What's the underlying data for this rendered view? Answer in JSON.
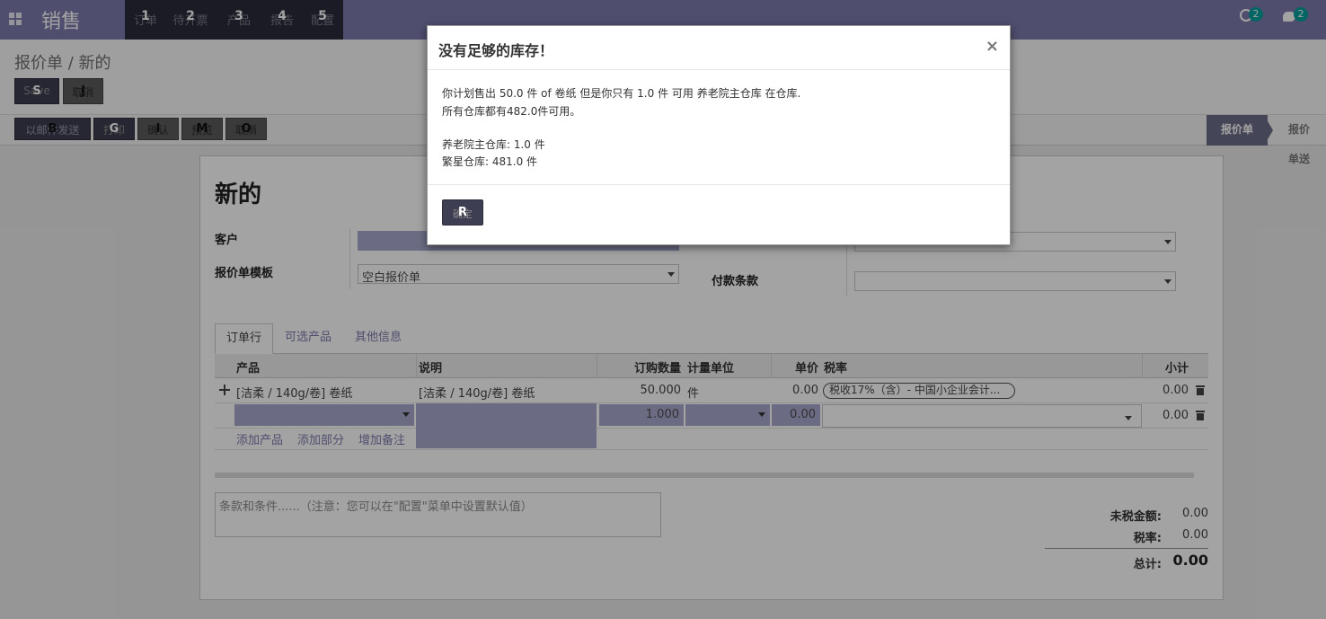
{
  "nav": {
    "app_title": "销售",
    "menu": [
      {
        "label": "订单",
        "hint": "1"
      },
      {
        "label": "待开票",
        "hint": "2"
      },
      {
        "label": "产品",
        "hint": "3"
      },
      {
        "label": "报告",
        "hint": "4"
      },
      {
        "label": "配置",
        "hint": "5"
      }
    ],
    "activity_count": "2",
    "message_count": "2"
  },
  "control": {
    "breadcrumb": "报价单 / 新的",
    "save_label": "Save",
    "save_hint": "S",
    "discard_label": "取消",
    "discard_hint": "J",
    "actions": [
      {
        "label": "以邮件发送",
        "hint": "B"
      },
      {
        "label": "打印",
        "hint": "G"
      },
      {
        "label": "确认",
        "hint": "I"
      },
      {
        "label": "预览",
        "hint": "M"
      },
      {
        "label": "取消",
        "hint": "O"
      }
    ],
    "stages": [
      "报价单",
      "报价单送"
    ]
  },
  "form": {
    "title": "新的",
    "customer_label": "客户",
    "template_label": "报价单模板",
    "template_value": "空白报价单",
    "payment_terms_label": "付款条款",
    "tabs": [
      "订单行",
      "可选产品",
      "其他信息"
    ],
    "columns": [
      "产品",
      "说明",
      "订购数量",
      "计量单位",
      "单价",
      "税率",
      "小计"
    ],
    "line": {
      "product": "[洁柔 / 140g/卷] 卷纸",
      "description": "[洁柔 / 140g/卷] 卷纸",
      "qty": "50.000",
      "uom": "件",
      "price": "0.00",
      "tax": "税收17%（含）- 中国小企业会计...",
      "subtotal": "0.00"
    },
    "new_line": {
      "qty": "1.000",
      "price": "0.00",
      "subtotal": "0.00"
    },
    "add_links": [
      "添加产品",
      "添加部分",
      "增加备注"
    ],
    "notes_placeholder": "条款和条件......（注意：您可以在\"配置\"菜单中设置默认值）",
    "totals": {
      "untaxed_label": "未税金额:",
      "untaxed_value": "0.00",
      "tax_label": "税率:",
      "tax_value": "0.00",
      "total_label": "总计:",
      "total_value": "0.00"
    }
  },
  "modal": {
    "title": "没有足够的库存！",
    "close": "×",
    "lines": [
      "你计划售出 50.0 件 of 卷纸 但是你只有 1.0 件 可用 养老院主仓库 在仓库.",
      "所有仓库都有482.0件可用。",
      "养老院主仓库: 1.0 件",
      "繁星仓库: 481.0 件"
    ],
    "ok_label": "确定",
    "ok_hint": "R"
  }
}
